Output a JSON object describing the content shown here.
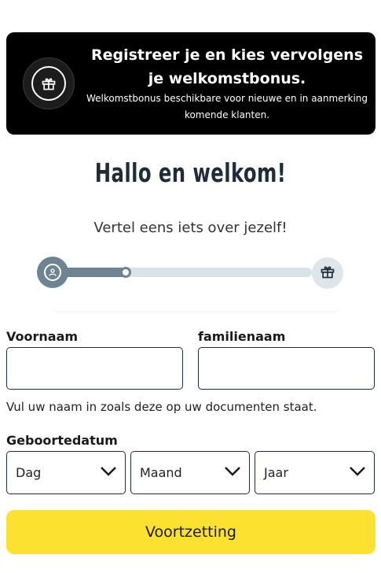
{
  "promo": {
    "title": "Registreer je en kies vervolgens je welkomstbonus.",
    "subtitle": "Welkomstbonus beschikbare voor nieuwe en in aanmerking komende klanten.",
    "icon": "gift-icon",
    "background": "#000000"
  },
  "header": {
    "title": "Hallo en welkom!",
    "subtitle": "Vertel eens iets over jezelf!"
  },
  "progress": {
    "start_icon": "user-icon",
    "end_icon": "gift-icon",
    "step_fraction": 0.27
  },
  "form": {
    "first_name": {
      "label": "Voornaam",
      "value": "",
      "placeholder": ""
    },
    "last_name": {
      "label": "familienaam",
      "value": "",
      "placeholder": ""
    },
    "name_hint": "Vul uw naam in zoals deze op uw documenten staat.",
    "dob": {
      "label": "Geboortedatum",
      "day": "Dag",
      "month": "Maand",
      "year": "Jaar"
    }
  },
  "actions": {
    "continue_label": "Voortzetting",
    "accent": "#fde131"
  }
}
